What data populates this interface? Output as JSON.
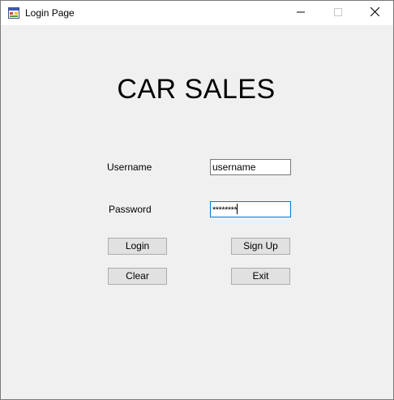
{
  "window": {
    "title": "Login Page"
  },
  "main": {
    "heading": "CAR SALES",
    "username_label": "Username",
    "password_label": "Password",
    "username_value": "username",
    "password_value": "********"
  },
  "buttons": {
    "login": "Login",
    "signup": "Sign Up",
    "clear": "Clear",
    "exit": "Exit"
  },
  "icons": {
    "app": "app-window-icon",
    "minimize": "minimize-icon",
    "maximize": "maximize-icon",
    "close": "close-icon"
  },
  "colors": {
    "focus_border": "#0078d7",
    "window_bg": "#f0f0f0",
    "button_bg": "#e1e1e1"
  }
}
